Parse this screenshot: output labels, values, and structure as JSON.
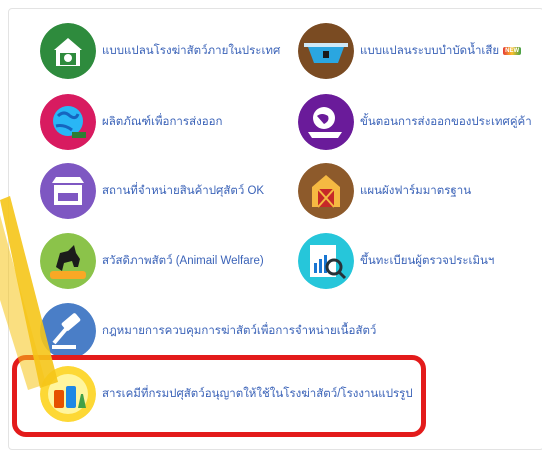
{
  "menu": {
    "items": [
      {
        "label": "แบบแปลนโรงฆ่าสัตว์ภายในประเทศ",
        "icon": "farm-building-icon",
        "new": false
      },
      {
        "label": "แบบแปลนระบบบำบัดน้ำเสีย",
        "icon": "water-treatment-icon",
        "new": true,
        "badge": "NEW"
      },
      {
        "label": "ผลิตภัณฑ์เพื่อการส่งออก",
        "icon": "export-globe-icon",
        "new": false
      },
      {
        "label": "ขั้นตอนการส่งออกของประเทศคู่ค้า",
        "icon": "export-world-ship-icon",
        "new": false
      },
      {
        "label": "สถานที่จำหน่ายสินค้าปศุสัตว์ OK",
        "icon": "ok-shop-icon",
        "new": false
      },
      {
        "label": "แผนผังฟาร์มมาตรฐาน",
        "icon": "barn-icon",
        "new": false
      },
      {
        "label": "สวัสดิภาพสัตว์ (Animail Welfare)",
        "icon": "animal-welfare-horse-icon",
        "new": false
      },
      {
        "label": "ขึ้นทะเบียนผู้ตรวจประเมินฯ",
        "icon": "document-magnifier-icon",
        "new": false
      },
      {
        "label": "กฎหมายการควบคุมการฆ่าสัตว์เพื่อการจำหน่ายเนื้อสัตว์",
        "icon": "gavel-icon",
        "new": false
      },
      {
        "label": "สารเคมีที่กรมปศุสัตว์อนุญาตให้ใช้ในโรงฆ่าสัตว์/โรงงานแปรรูป",
        "icon": "chemical-bottles-icon",
        "new": false
      }
    ]
  },
  "colors": {
    "link": "#3b63b8",
    "highlight": "#e31b1b",
    "pointer": "#f5c518"
  }
}
